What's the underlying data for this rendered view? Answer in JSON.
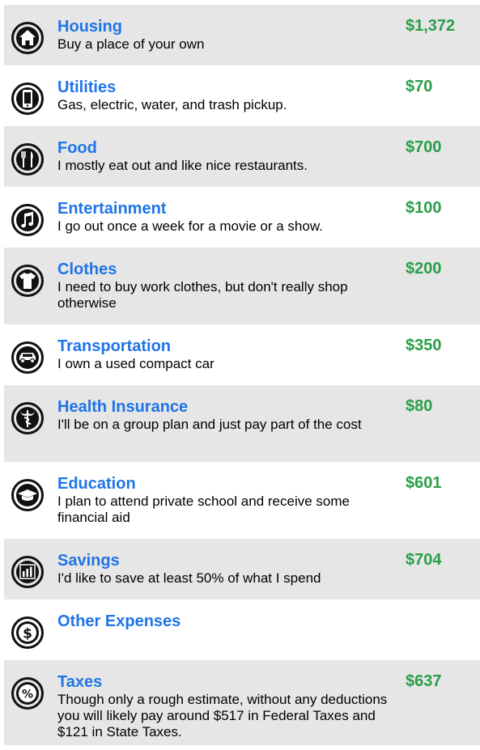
{
  "colors": {
    "title": "#1f74e8",
    "amount": "#2b9e4a",
    "shaded_row": "#e6e6e6",
    "text": "#000000"
  },
  "items": [
    {
      "title": "Housing",
      "description": "Buy a place of your own",
      "amount": "$1,372",
      "icon": "house-icon"
    },
    {
      "title": "Utilities",
      "description": "Gas, electric, water, and trash pickup.",
      "amount": "$70",
      "icon": "phone-icon"
    },
    {
      "title": "Food",
      "description": "I mostly eat out and like nice restaurants.",
      "amount": "$700",
      "icon": "fork-knife-icon"
    },
    {
      "title": "Entertainment",
      "description": "I go out once a week for a movie or a show.",
      "amount": "$100",
      "icon": "music-note-icon"
    },
    {
      "title": "Clothes",
      "description": "I need to buy work clothes, but don't really shop otherwise",
      "amount": "$200",
      "icon": "shirt-icon"
    },
    {
      "title": "Transportation",
      "description": "I own a used compact car",
      "amount": "$350",
      "icon": "car-icon"
    },
    {
      "title": "Health Insurance",
      "description": "I'll be on a group plan and just pay part of the cost",
      "amount": "$80",
      "icon": "caduceus-icon"
    },
    {
      "title": "Education",
      "description": "I plan to attend private school and receive some financial aid",
      "amount": "$601",
      "icon": "graduation-cap-icon"
    },
    {
      "title": "Savings",
      "description": "I'd like to save at least 50% of what I spend",
      "amount": "$704",
      "icon": "bar-chart-icon"
    },
    {
      "title": "Other Expenses",
      "description": "",
      "amount": "",
      "icon": "dollar-icon"
    },
    {
      "title": "Taxes",
      "description": "Though only a rough estimate, without any deductions you will likely pay around $517 in Federal Taxes and $121 in State Taxes.",
      "amount": "$637",
      "icon": "percent-icon"
    }
  ]
}
